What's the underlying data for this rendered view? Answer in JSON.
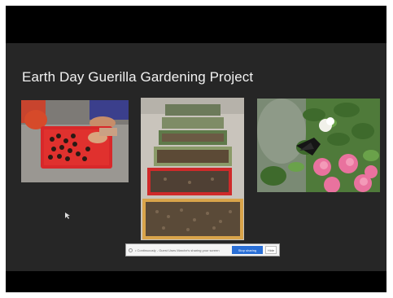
{
  "slide": {
    "title": "Earth Day Guerilla Gardening Project",
    "photos": [
      {
        "name": "seed-balls-tray-photo"
      },
      {
        "name": "seed-trays-photo"
      },
      {
        "name": "butterfly-flowers-photo"
      }
    ]
  },
  "share_bar": {
    "message": "• Continuously - Guest Uses Marche's sharing your screen",
    "stop_label": "Stop sharing",
    "hide_label": "Hide"
  },
  "colors": {
    "slide_background": "#262626",
    "letterbox": "#000000",
    "title_text": "#f2f2f2",
    "stop_button": "#2a6fd6"
  }
}
